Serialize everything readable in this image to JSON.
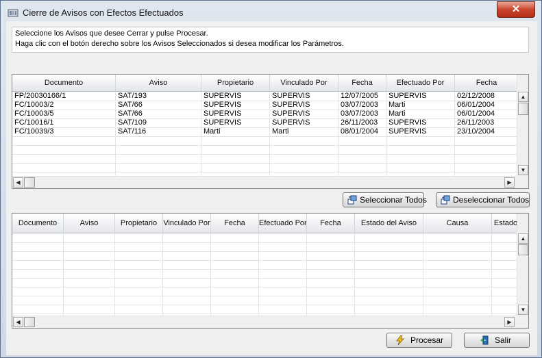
{
  "window": {
    "title": "Cierre de Avisos con Efectos Efectuados",
    "close_label": "✕"
  },
  "instructions": {
    "line1": "Seleccione los Avisos que desee Cerrar y pulse Procesar.",
    "line2": "Haga clic con el botón derecho sobre los Avisos Seleccionados si desea modificar los Parámetros."
  },
  "top_grid": {
    "columns": [
      "Documento",
      "Aviso",
      "Propietario",
      "Vinculado Por",
      "Fecha",
      "Efectuado Por",
      "Fecha"
    ],
    "rows": [
      [
        "FP/20030166/1",
        "SAT/193",
        "SUPERVIS",
        "SUPERVIS",
        "12/07/2005",
        "SUPERVIS",
        "02/12/2008"
      ],
      [
        "FC/10003/2",
        "SAT/66",
        "SUPERVIS",
        "SUPERVIS",
        "03/07/2003",
        "Marti",
        "06/01/2004"
      ],
      [
        "FC/10003/5",
        "SAT/66",
        "SUPERVIS",
        "SUPERVIS",
        "03/07/2003",
        "Marti",
        "06/01/2004"
      ],
      [
        "FC/10016/1",
        "SAT/109",
        "SUPERVIS",
        "SUPERVIS",
        "26/11/2003",
        "SUPERVIS",
        "26/11/2003"
      ],
      [
        "FC/10039/3",
        "SAT/116",
        "Marti",
        "Marti",
        "08/01/2004",
        "SUPERVIS",
        "23/10/2004"
      ]
    ]
  },
  "buttons": {
    "select_all": "Seleccionar Todos",
    "deselect_all": "Deseleccionar Todos",
    "process": "Procesar",
    "exit": "Salir"
  },
  "bottom_grid": {
    "columns": [
      "Documento",
      "Aviso",
      "Propietario",
      "Vinculado Por",
      "Fecha",
      "Efectuado Por",
      "Fecha",
      "Estado del Aviso",
      "Causa",
      "Estado"
    ]
  },
  "colors": {
    "title_bar": "#dfe6ef",
    "close_button": "#c9452d",
    "grid_border": "#828790"
  }
}
